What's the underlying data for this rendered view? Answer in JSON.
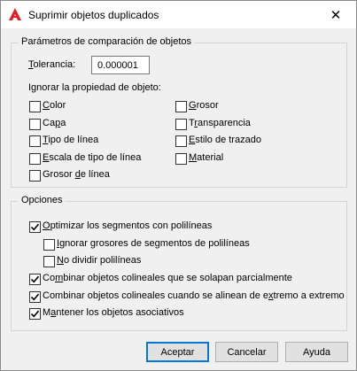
{
  "window": {
    "title": "Suprimir objetos duplicados",
    "close_glyph": "✕"
  },
  "params": {
    "title": "Parámetros de comparación de objetos",
    "tolerance_label_u": "T",
    "tolerance_label_rest": "olerancia:",
    "tolerance_value": "0.000001",
    "ignore_label": "Ignorar la propiedad de objeto:",
    "props": [
      {
        "pre": "",
        "u": "C",
        "post": "olor",
        "checked": false
      },
      {
        "pre": "Ca",
        "u": "p",
        "post": "a",
        "checked": false
      },
      {
        "pre": "",
        "u": "T",
        "post": "ipo de línea",
        "checked": false
      },
      {
        "pre": "",
        "u": "E",
        "post": "scala de tipo de línea",
        "checked": false
      },
      {
        "pre": "Grosor ",
        "u": "d",
        "post": "e línea",
        "checked": false
      },
      {
        "pre": "",
        "u": "G",
        "post": "rosor",
        "checked": false
      },
      {
        "pre": "T",
        "u": "r",
        "post": "ansparencia",
        "checked": false
      },
      {
        "pre": "",
        "u": "E",
        "post": "stilo de trazado",
        "checked": false
      },
      {
        "pre": "",
        "u": "M",
        "post": "aterial",
        "checked": false
      }
    ]
  },
  "options": {
    "title": "Opciones",
    "items": [
      {
        "pre": "",
        "u": "O",
        "post": "ptimizar los segmentos con polilíneas",
        "checked": true
      },
      {
        "pre": "",
        "u": "I",
        "post": "gnorar grosores de segmentos de polilíneas",
        "checked": false
      },
      {
        "pre": "",
        "u": "N",
        "post": "o dividir polilíneas",
        "checked": false
      },
      {
        "pre": "Co",
        "u": "m",
        "post": "binar objetos colineales que se solapan parcialmente",
        "checked": true
      },
      {
        "pre": "Combinar objetos colineales cuando se alinean de e",
        "u": "x",
        "post": "tremo a extremo",
        "checked": true
      },
      {
        "pre": "M",
        "u": "a",
        "post": "ntener los objetos asociativos",
        "checked": true
      }
    ]
  },
  "buttons": {
    "accept": "Aceptar",
    "cancel": "Cancelar",
    "help": "Ayuda"
  },
  "colors": {
    "accent": "#0078d7",
    "app_icon": "#e31e24"
  }
}
